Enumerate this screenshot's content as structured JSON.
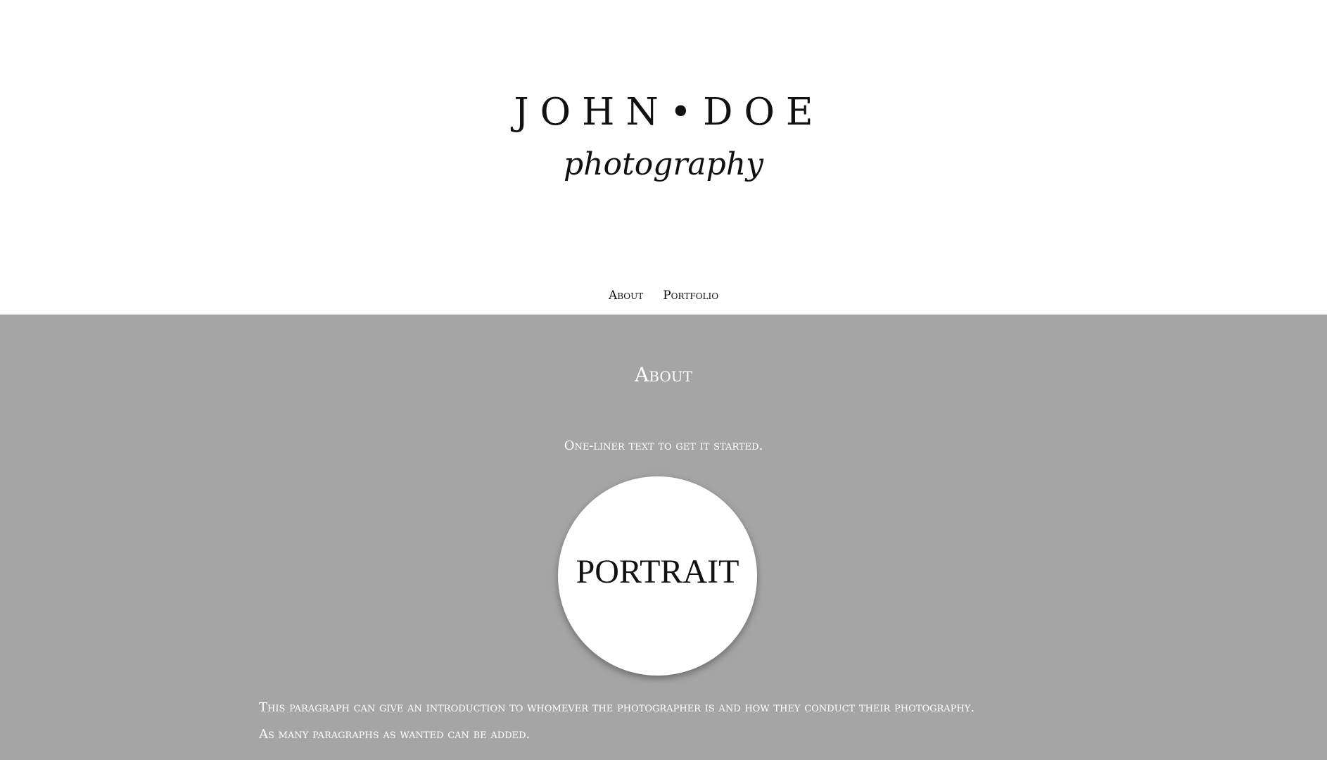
{
  "header": {
    "logo_name": "JOHN•DOE",
    "logo_tagline": "photography"
  },
  "nav": {
    "items": [
      {
        "label": "About"
      },
      {
        "label": "Portfolio"
      }
    ]
  },
  "about": {
    "heading": "About",
    "oneliner": "One-liner text to get it started.",
    "portrait_label": "PORTRAIT",
    "paragraphs": [
      "This paragraph can give an introduction to whomever the photographer is and how they conduct their photography.",
      "As many paragraphs as wanted can be added."
    ]
  },
  "colors": {
    "header_background": "#ffffff",
    "section_background": "#a5a5a5",
    "section_text": "#ffffff",
    "logo_text": "#111111"
  }
}
